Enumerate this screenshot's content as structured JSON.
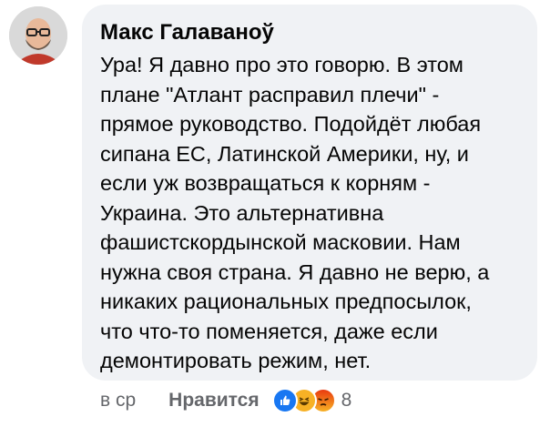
{
  "comment": {
    "author": "Макс Галаваноў",
    "text": "Ура! Я давно про это говорю. В этом\nплане \"Атлант расправил плечи\" -\nпрямое руководство. Подойдёт любая\nсипана ЕС, Латинской Америки, ну, и\nесли уж возвращаться к корням -\nУкраина. Это альтернативна\nфашистскордынской масковии. Нам\nнужна своя страна. Я давно не верю, а\nникаких рациональных предпосылок,\nчто что-то поменяется, даже если\nдемонтировать режим, нет."
  },
  "footer": {
    "time": "в ср",
    "like_label": "Нравится",
    "reaction_count": "8",
    "reaction_icons": [
      "like-icon",
      "haha-icon",
      "angry-icon"
    ]
  },
  "colors": {
    "bubble": "#f0f2f5",
    "text": "#050505",
    "secondary": "#65676b",
    "like_blue": "#1877f2",
    "haha_yellow": "#f7b125",
    "angry_red": "#e9710f"
  }
}
